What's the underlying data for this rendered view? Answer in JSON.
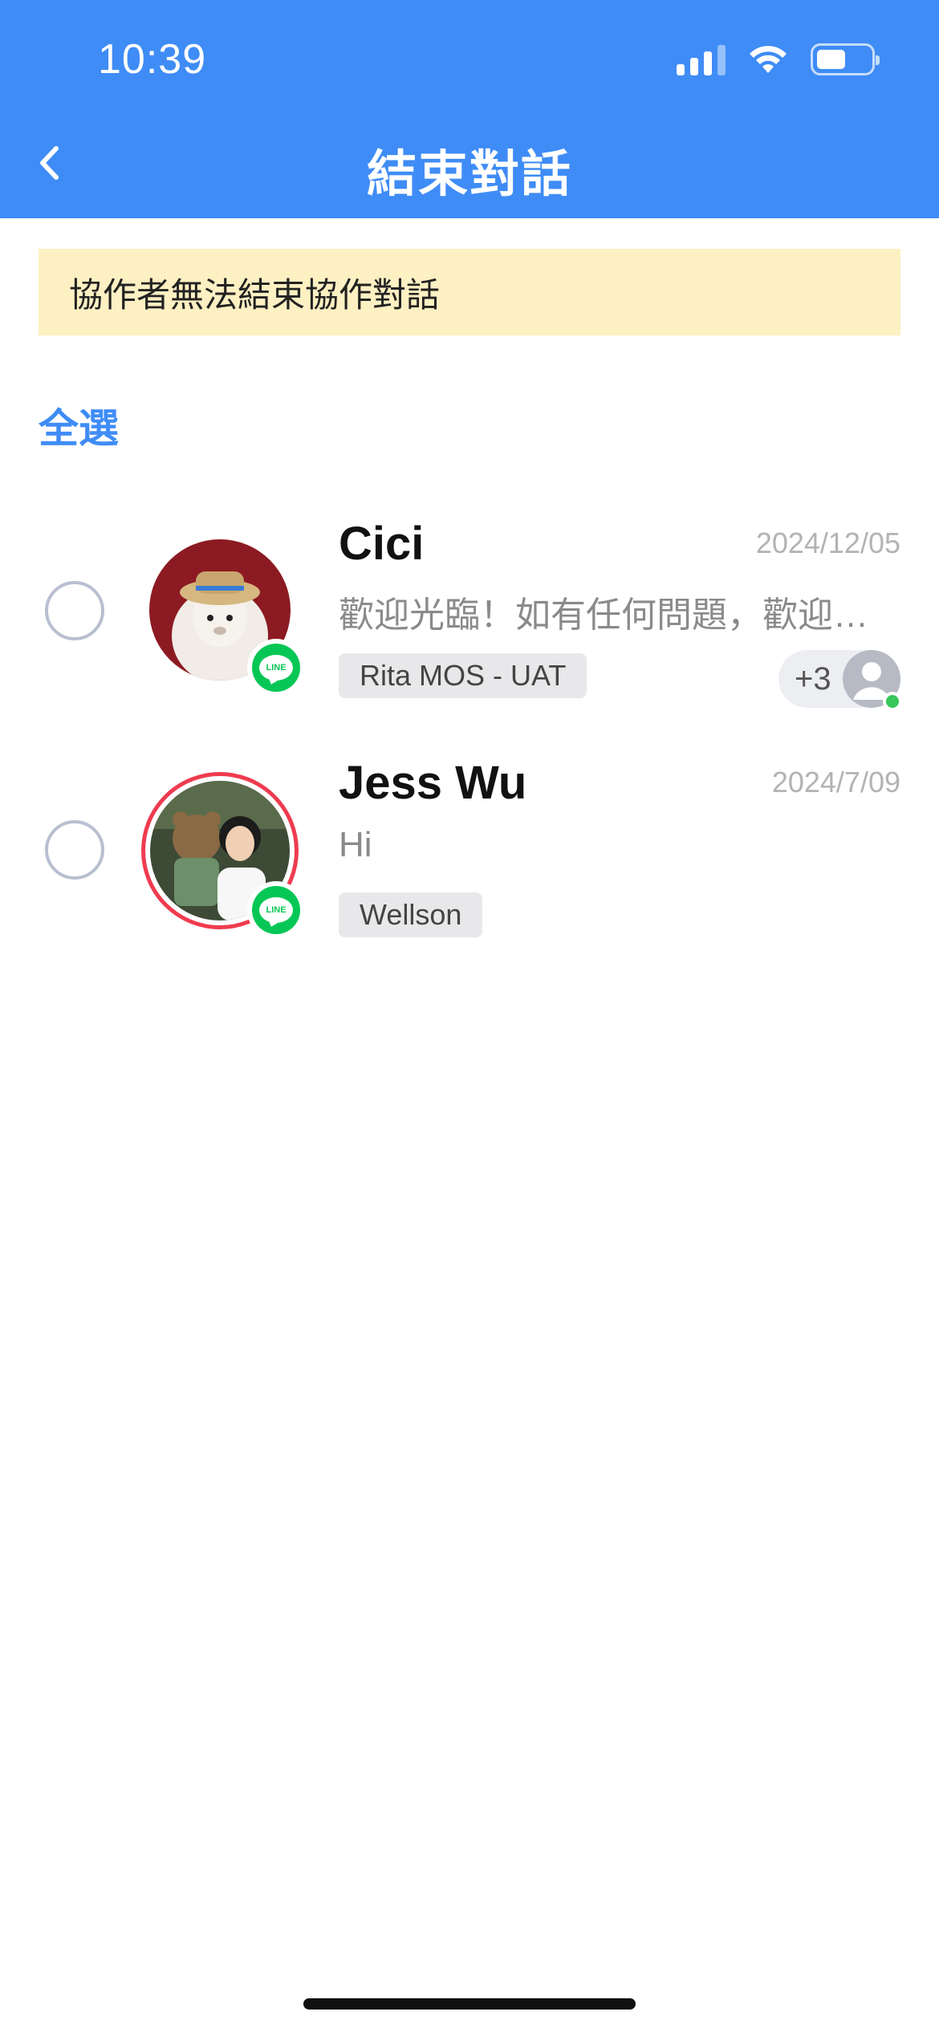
{
  "colors": {
    "accent": "#3f8cf6"
  },
  "status_bar": {
    "time": "10:39",
    "icons": [
      "cellular-signal-icon",
      "wifi-icon",
      "battery-icon"
    ]
  },
  "nav": {
    "title": "結束對話",
    "back_icon": "chevron-left-icon"
  },
  "notice": {
    "text": "協作者無法結束協作對話"
  },
  "select_all": {
    "label": "全選"
  },
  "conversations": [
    {
      "name": "Cici",
      "date": "2024/12/05",
      "preview": "歡迎光臨！如有任何問題，歡迎與我們聯繫",
      "tag": "Rita MOS - UAT",
      "channel": "LINE",
      "collaborators": {
        "count_label": "+3",
        "online": true
      }
    },
    {
      "name": "Jess Wu",
      "date": "2024/7/09",
      "preview": "Hi",
      "tag": "Wellson",
      "channel": "LINE"
    }
  ]
}
